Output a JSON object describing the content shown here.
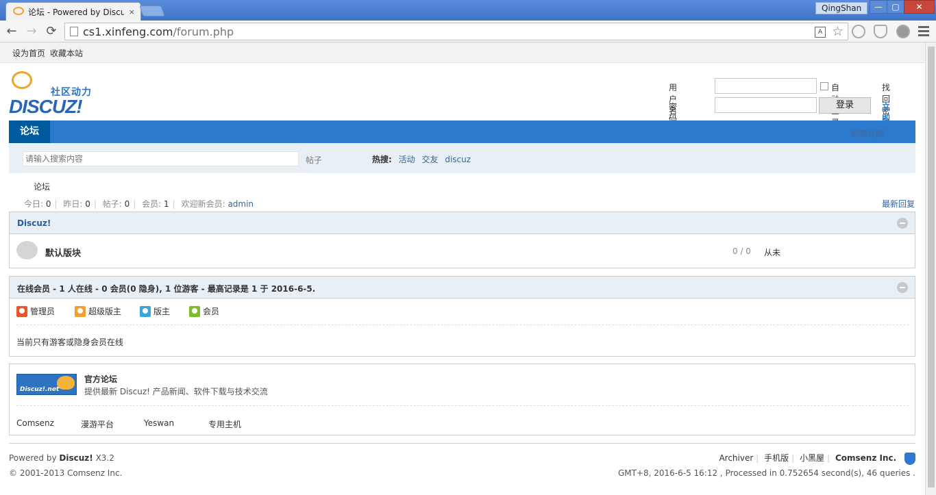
{
  "browser": {
    "tab_title": "论坛 - Powered by Discuz!",
    "tab_close": "×",
    "user_badge": "QingShan",
    "win_min": "—",
    "win_max": "▢",
    "win_close": "✕",
    "back": "←",
    "forward": "→",
    "reload": "⟳",
    "url_host": "cs1.xinfeng.com",
    "url_path": "/forum.php",
    "translate": "A",
    "star": "☆"
  },
  "topbar": {
    "set_home": "设为首页",
    "bookmark": "收藏本站"
  },
  "logo": {
    "tagline": "社区动力",
    "wordmark": "DISCUZ!"
  },
  "login": {
    "username_label": "用户名",
    "password_label": "密码",
    "auto_login": "自动登录",
    "forgot": "找回密码",
    "login_button": "登录",
    "register": "立即注册"
  },
  "nav": {
    "home": "论坛",
    "quick_nav": "快捷导航"
  },
  "search": {
    "placeholder": "请输入搜索内容",
    "type": "帖子",
    "hot_label": "热搜:",
    "hot_terms": [
      "活动",
      "交友",
      "discuz"
    ]
  },
  "breadcrumb": "论坛",
  "stats": {
    "today_label": "今日:",
    "today": "0",
    "yesterday_label": "昨日:",
    "yesterday": "0",
    "posts_label": "帖子:",
    "posts": "0",
    "members_label": "会员:",
    "members": "1",
    "welcome_label": "欢迎新会员:",
    "newest": "admin",
    "latest_reply": "最新回复"
  },
  "category": {
    "title": "Discuz!",
    "forum": {
      "name": "默认版块",
      "count": "0 / 0",
      "last": "从未"
    }
  },
  "online": {
    "title": "在线会员 - 1 人在线 - 0 会员(0 隐身), 1 位游客 - 最高记录是 1 于 2016-6-5.",
    "legend": [
      {
        "label": "管理员",
        "color": "#e4572e"
      },
      {
        "label": "超级版主",
        "color": "#f0a030"
      },
      {
        "label": "版主",
        "color": "#3aa4dd"
      },
      {
        "label": "会员",
        "color": "#7dbb2b"
      }
    ],
    "message": "当前只有游客或隐身会员在线"
  },
  "links": {
    "logo_text": "Discuz!.net",
    "title": "官方论坛",
    "desc": "提供最新 Discuz! 产品新闻、软件下载与技术交流",
    "items": [
      "Comsenz",
      "漫游平台",
      "Yeswan",
      "专用主机"
    ]
  },
  "footer": {
    "powered_prefix": "Powered by",
    "powered_name": "Discuz!",
    "version": "X3.2",
    "copyright": "© 2001-2013 Comsenz Inc.",
    "links": [
      "Archiver",
      "手机版",
      "小黑屋"
    ],
    "company": "Comsenz Inc.",
    "runtime": "GMT+8, 2016-6-5 16:12 , Processed in 0.752654 second(s), 46 queries ."
  }
}
